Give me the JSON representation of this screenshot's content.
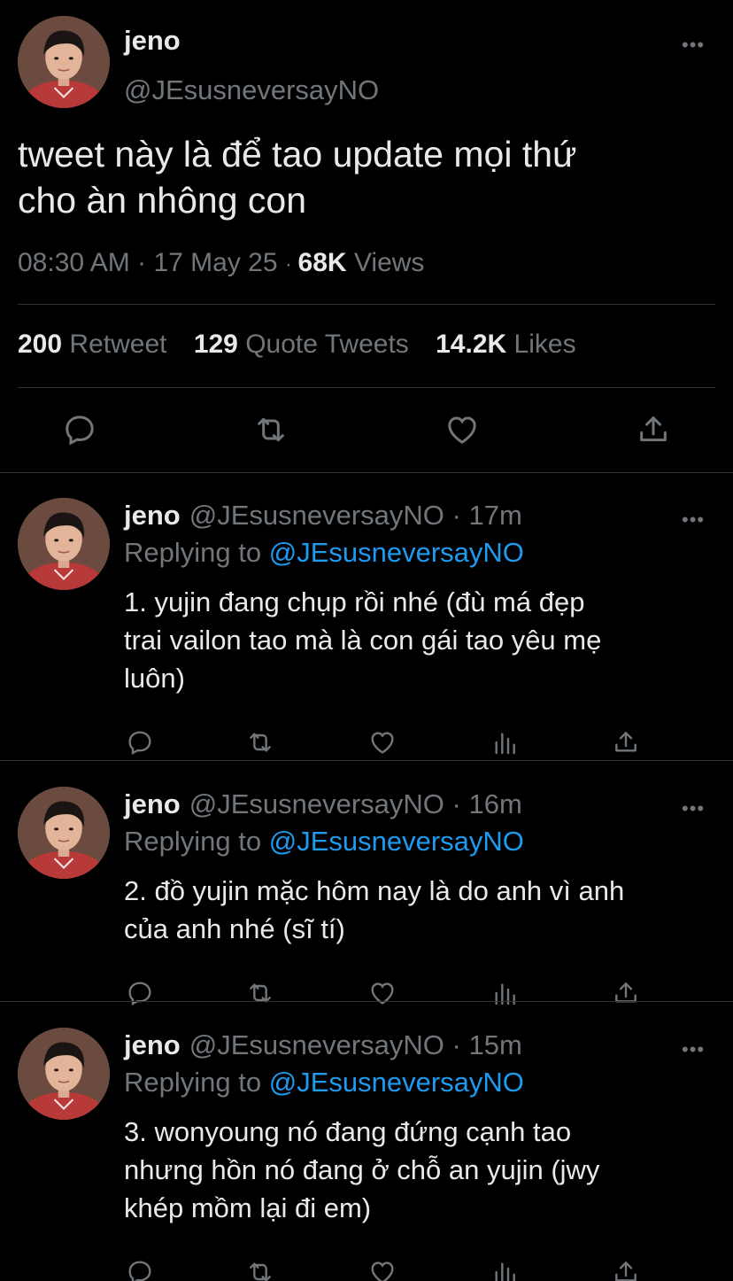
{
  "main_tweet": {
    "name": "jeno",
    "handle": "@JEsusneversayNO",
    "text_line1": "tweet này là để tao update mọi thứ",
    "text_line2": "cho àn nhông con",
    "time": "08:30 AM",
    "date": "17 May 25",
    "views_count": "68K",
    "views_label": "Views",
    "retweets_count": "200",
    "retweets_label": "Retweet",
    "quotes_count": "129",
    "quotes_label": "Quote Tweets",
    "likes_count": "14.2K",
    "likes_label": "Likes",
    "more_icon": "more-horizontal-icon",
    "actions": [
      "reply-icon",
      "retweet-icon",
      "like-icon",
      "share-icon"
    ]
  },
  "replies": [
    {
      "name": "jeno",
      "handle": "@JEsusneversayNO",
      "time": "17m",
      "replying_label": "Replying to",
      "replying_to": "@JEsusneversayNO",
      "lines": [
        "1. yujin đang chụp rồi nhé (đù má đẹp",
        "trai vailon tao mà là con gái tao yêu mẹ",
        "luôn)"
      ]
    },
    {
      "name": "jeno",
      "handle": "@JEsusneversayNO",
      "time": "16m",
      "replying_label": "Replying to",
      "replying_to": "@JEsusneversayNO",
      "lines": [
        "2. đồ yujin mặc hôm nay là do anh vì anh",
        "của anh nhé (sĩ tí)"
      ]
    },
    {
      "name": "jeno",
      "handle": "@JEsusneversayNO",
      "time": "15m",
      "replying_label": "Replying to",
      "replying_to": "@JEsusneversayNO",
      "lines": [
        "3. wonyoung nó đang đứng cạnh tao",
        "nhưng hồn nó đang ở chỗ an yujin (jwy",
        "khép mồm lại đi em)"
      ]
    }
  ],
  "colors": {
    "background": "#000000",
    "text": "#e7e9ea",
    "secondary": "#71767b",
    "link": "#1d9bf0",
    "divider": "#2f3336"
  }
}
